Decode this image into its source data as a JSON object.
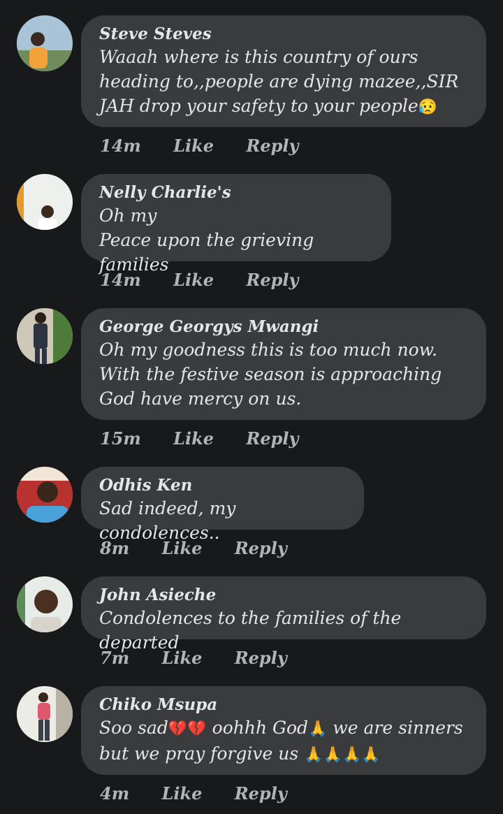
{
  "comments": [
    {
      "author": "Steve Steves",
      "text": "Waaah where is this country of ours heading to,,people are dying mazee,,SIR JAH drop your safety to your people",
      "emoji": "😥",
      "time": "14m",
      "like": "Like",
      "reply": "Reply"
    },
    {
      "author": "Nelly Charlie's",
      "text": "Oh my\nPeace upon the grieving families",
      "time": "14m",
      "like": "Like",
      "reply": "Reply"
    },
    {
      "author": "George Georgys Mwangi",
      "text": "Oh my goodness this is too much now. With the festive season is approaching God have mercy on us.",
      "time": "15m",
      "like": "Like",
      "reply": "Reply"
    },
    {
      "author": "Odhis Ken",
      "text": "Sad indeed, my condolences..",
      "time": "8m",
      "like": "Like",
      "reply": "Reply"
    },
    {
      "author": "John Asieche",
      "text": "Condolences to the families of the departed",
      "time": "7m",
      "like": "Like",
      "reply": "Reply"
    },
    {
      "author": "Chiko Msupa",
      "text_part1": "Soo sad",
      "emoji1": "💔💔",
      "text_part2": " oohhh God",
      "emoji2": "🙏",
      "text_part3": " we are sinners but we pray forgive us ",
      "emoji3": "🙏🙏🙏🙏",
      "time": "4m",
      "like": "Like",
      "reply": "Reply"
    }
  ],
  "colors": {
    "background": "#18191a",
    "bubble": "#3a3b3c",
    "text": "#e4e6eb",
    "meta": "#b0b3b8"
  }
}
